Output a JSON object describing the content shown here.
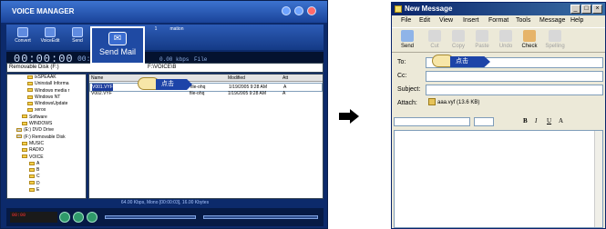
{
  "voice_manager": {
    "title": "VOICE MANAGER",
    "toolbar": [
      "Convert",
      "VoiceEdit",
      "Send",
      "",
      "1",
      "mation"
    ],
    "lcd": {
      "time": "00:00:00",
      "sub_time": "00:00:00",
      "rate": "0.00 kbps",
      "file": "File"
    },
    "popup_label": "Send Mail",
    "drive_label": "Removable Disk (F:)",
    "path_value": "F:\\VOICE\\B",
    "tree": [
      "ixSPEAAK",
      "Uninstall Informa",
      "Windows media r",
      "Windows NT",
      "WindowsUpdate",
      "xerox",
      "Software",
      "WINDOWS",
      "(E:) DVD Drive",
      "(F:) Removable Disk",
      "MUSIC",
      "RADIO",
      "VOICE",
      "A",
      "B",
      "C",
      "D",
      "E"
    ],
    "columns": [
      "Name",
      "",
      "Modified",
      "Att"
    ],
    "files": [
      {
        "name": "V001.VYF",
        "type": "file-ohq",
        "modified": "1/19/2005 9:28 AM",
        "attr": "A"
      },
      {
        "name": "V002.VYF",
        "type": "file-ohq",
        "modified": "1/19/2005 9:28 AM",
        "attr": "A"
      }
    ],
    "tag_label": "点击",
    "status": "64.00 Kbps, Mono [00:00:03], 16.00 Kbytes",
    "readout": "00:00"
  },
  "new_message": {
    "title": "New Message",
    "menu": [
      "File",
      "Edit",
      "View",
      "Insert",
      "Format",
      "Tools",
      "Message",
      "Help"
    ],
    "toolbar": [
      "Send",
      "Cut",
      "Copy",
      "Paste",
      "Undo",
      "Check",
      "Spelling"
    ],
    "to_label": "To:",
    "cc_label": "Cc:",
    "subject_label": "Subject:",
    "attach_label": "Attach:",
    "attachment": "aaa.vyf (13.6 KB)",
    "tag_label": "点击",
    "format_buttons": [
      "B",
      "I",
      "U",
      "A"
    ]
  }
}
